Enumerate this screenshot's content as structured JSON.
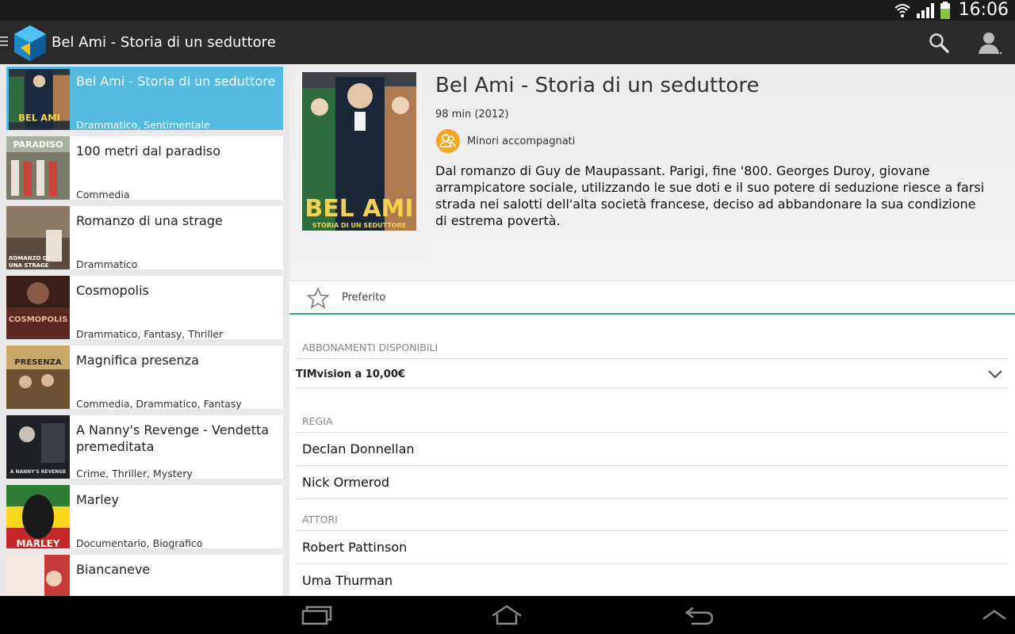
{
  "status": {
    "time": "16:06"
  },
  "app": {
    "title": "Bel Ami - Storia di un seduttore"
  },
  "list": [
    {
      "title": "Bel Ami - Storia di un seduttore",
      "genres": "Drammatico, Sentimentale",
      "selected": true,
      "poster_text": "BEL AMI"
    },
    {
      "title": "100 metri dal paradiso",
      "genres": "Commedia",
      "poster_text": "PARADISO"
    },
    {
      "title": "Romanzo di una strage",
      "genres": "Drammatico",
      "poster_text": "ROMANZO DI UNA STRAGE"
    },
    {
      "title": "Cosmopolis",
      "genres": "Drammatico, Fantasy, Thriller",
      "poster_text": "COSMOPOLIS"
    },
    {
      "title": "Magnifica presenza",
      "genres": "Commedia, Drammatico, Fantasy",
      "poster_text": "PRESENZA"
    },
    {
      "title": "A Nanny's Revenge - Vendetta premeditata",
      "genres": "Crime, Thriller, Mystery",
      "poster_text": "A NANNY'S REVENGE"
    },
    {
      "title": "Marley",
      "genres": "Documentario, Biografico",
      "poster_text": "MARLEY"
    },
    {
      "title": "Biancaneve",
      "genres": ""
    }
  ],
  "detail": {
    "title": "Bel Ami - Storia di un seduttore",
    "meta": "98 min (2012)",
    "rating": "Minori accompagnati",
    "description": "Dal romanzo di Guy de Maupassant. Parigi, fine '800. Georges Duroy, giovane arrampicatore sociale, utilizzando le sue doti e il suo potere di seduzione riesce a farsi strada nei salotti dell'alta società francese, deciso ad abbandonare la sua condizione di estrema povertà.",
    "poster_title": "BEL AMI",
    "poster_subtitle": "STORIA DI UN SEDUTTORE",
    "favorite_label": "Preferito",
    "subscriptions_header": "ABBONAMENTI DISPONIBILI",
    "subscription_selected": "TIMvision a 10,00€",
    "director_header": "REGIA",
    "directors": [
      "Declan Donnellan",
      "Nick Ormerod"
    ],
    "actors_header": "ATTORI",
    "actors": [
      "Robert Pattinson",
      "Uma Thurman"
    ]
  },
  "colors": {
    "accent": "#55b9e0",
    "divider": "#33a2c9",
    "rating": "#f5a623"
  }
}
